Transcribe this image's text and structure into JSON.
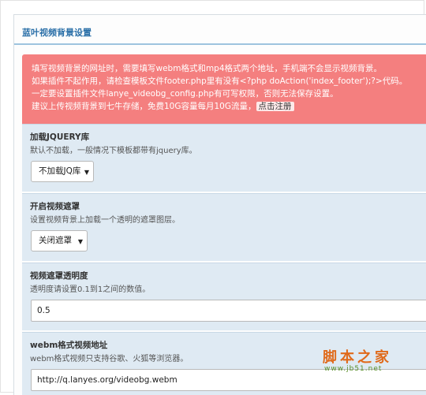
{
  "page": {
    "title": "蓝叶视频背景设置"
  },
  "alert": {
    "lines": [
      "填写视频背景的网址时，需要填写webm格式和mp4格式两个地址，手机端不会显示视频背景。",
      "如果插件不起作用，请检查模板文件footer.php里有没有<?php doAction('index_footer');?>代码。",
      "一定要设置插件文件lanye_videobg_config.php有可写权限，否则无法保存设置。",
      "建议上传视频背景到七牛存储，免费10G容量每月10G流量，"
    ],
    "link_label": "点击注册"
  },
  "sections": [
    {
      "title": "加载JQUERY库",
      "description": "默认不加载，一般情况下模板都带有jquery库。",
      "control": "select",
      "value": "不加载JQ库"
    },
    {
      "title": "开启视频遮罩",
      "description": "设置视频背景上加载一个透明的遮罩图层。",
      "control": "select",
      "value": "关闭遮罩"
    },
    {
      "title": "视频遮罩透明度",
      "description": "透明度请设置0.1到1之间的数值。",
      "control": "input",
      "value": "0.5"
    },
    {
      "title": "webm格式视频地址",
      "description": "webm格式视频只支持谷歌、火狐等浏览器。",
      "control": "input",
      "value": "http://q.lanyes.org/videobg.webm"
    }
  ],
  "watermark": {
    "main": "脚本之家",
    "url": "www.jb51.net"
  },
  "icons": {
    "select_arrow": "caret-down-icon"
  },
  "colors": {
    "alert_bg": "#f47f7f",
    "section_bg": "#dfeaf3",
    "title_color": "#2a6fa8"
  }
}
